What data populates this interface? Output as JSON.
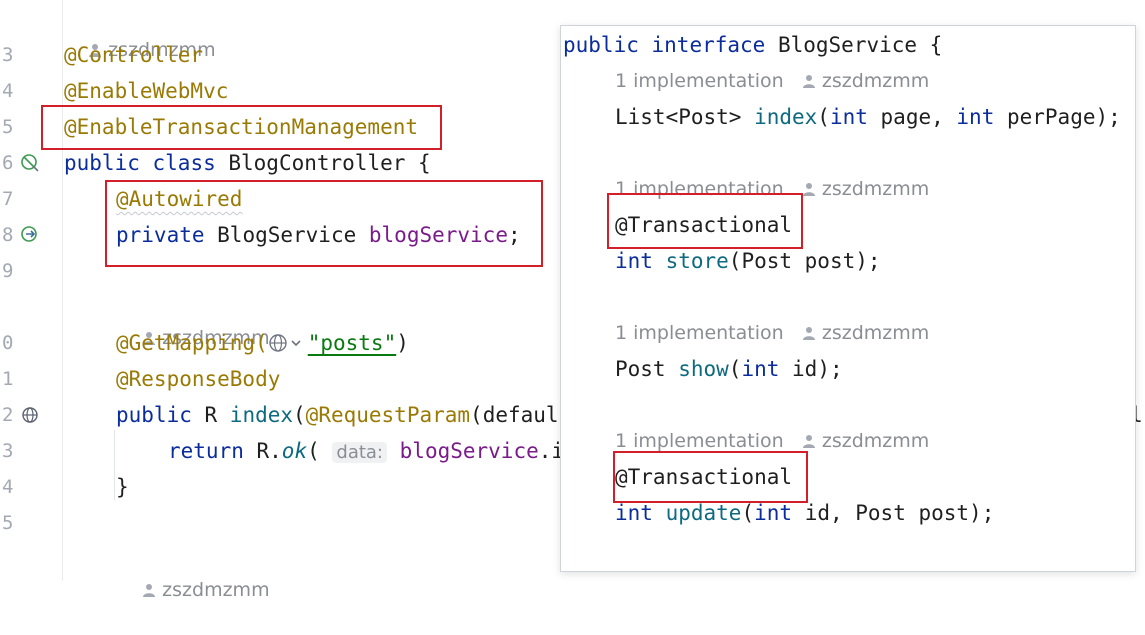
{
  "gutter": {
    "line_numbers": [
      "3",
      "4",
      "5",
      "6",
      "7",
      "8",
      "9",
      "0",
      "1",
      "2",
      "3",
      "4",
      "5"
    ]
  },
  "editor": {
    "author_top": "zszdmzmm",
    "line3": "@Controller",
    "line4": "@EnableWebMvc",
    "line5": "@EnableTransactionManagement",
    "line6_kw1": "public",
    "line6_kw2": "class",
    "line6_rest": " BlogController {",
    "line7": "@Autowired",
    "line8_kw": "private",
    "line8_type": " BlogService ",
    "line8_field": "blogService",
    "line8_end": ";",
    "author_mid": "zszdmzmm",
    "line10_ann": "@GetMapping(",
    "line10_str": "\"posts\"",
    "line10_end": ")",
    "line11": "@ResponseBody",
    "line12_kw": "public",
    "line12_type": " R ",
    "line12_fn": "index",
    "line12_paren": "(",
    "line12_ann": "@RequestParam",
    "line12_rest": "(defaul",
    "line12_tail": "l",
    "line13_kw": "return",
    "line13_mid": " R.",
    "line13_fn": "ok",
    "line13_paren": "( ",
    "line13_hint": "data:",
    "line13_field": "blogService",
    "line13_rest": ".in",
    "line14": "}",
    "author_bottom": "zszdmzmm"
  },
  "popup": {
    "decl_kw1": "public",
    "decl_kw2": "interface",
    "decl_rest": " BlogService {",
    "impl1": "1 implementation",
    "author1": "zszdmzmm",
    "m1_type": "List<Post> ",
    "m1_fn": "index",
    "m1_p1": "(",
    "m1_kw1": "int",
    "m1_p2": " page, ",
    "m1_kw2": "int",
    "m1_p3": " perPage);",
    "impl2": "1 implementation",
    "author2": "zszdmzmm",
    "ann2": "@Transactional",
    "m2_kw": "int",
    "m2_fn": " store",
    "m2_rest": "(Post post);",
    "impl3": "1 implementation",
    "author3": "zszdmzmm",
    "m3_type": "Post ",
    "m3_fn": "show",
    "m3_p1": "(",
    "m3_kw": "int",
    "m3_rest": " id);",
    "impl4": "1 implementation",
    "author4": "zszdmzmm",
    "ann4": "@Transactional",
    "m4_kw": "int",
    "m4_fn": " update",
    "m4_p1": "(",
    "m4_kw2": "int",
    "m4_rest": " id, Post post);"
  },
  "colors": {
    "keyword": "#0b2d9c",
    "annotation": "#9a7a05",
    "highlight_box": "#d21f2a"
  },
  "icons": [
    "user-icon",
    "run-gutter-icon",
    "navigate-gutter-icon",
    "web-endpoint-gutter-icon",
    "globe-icon"
  ]
}
